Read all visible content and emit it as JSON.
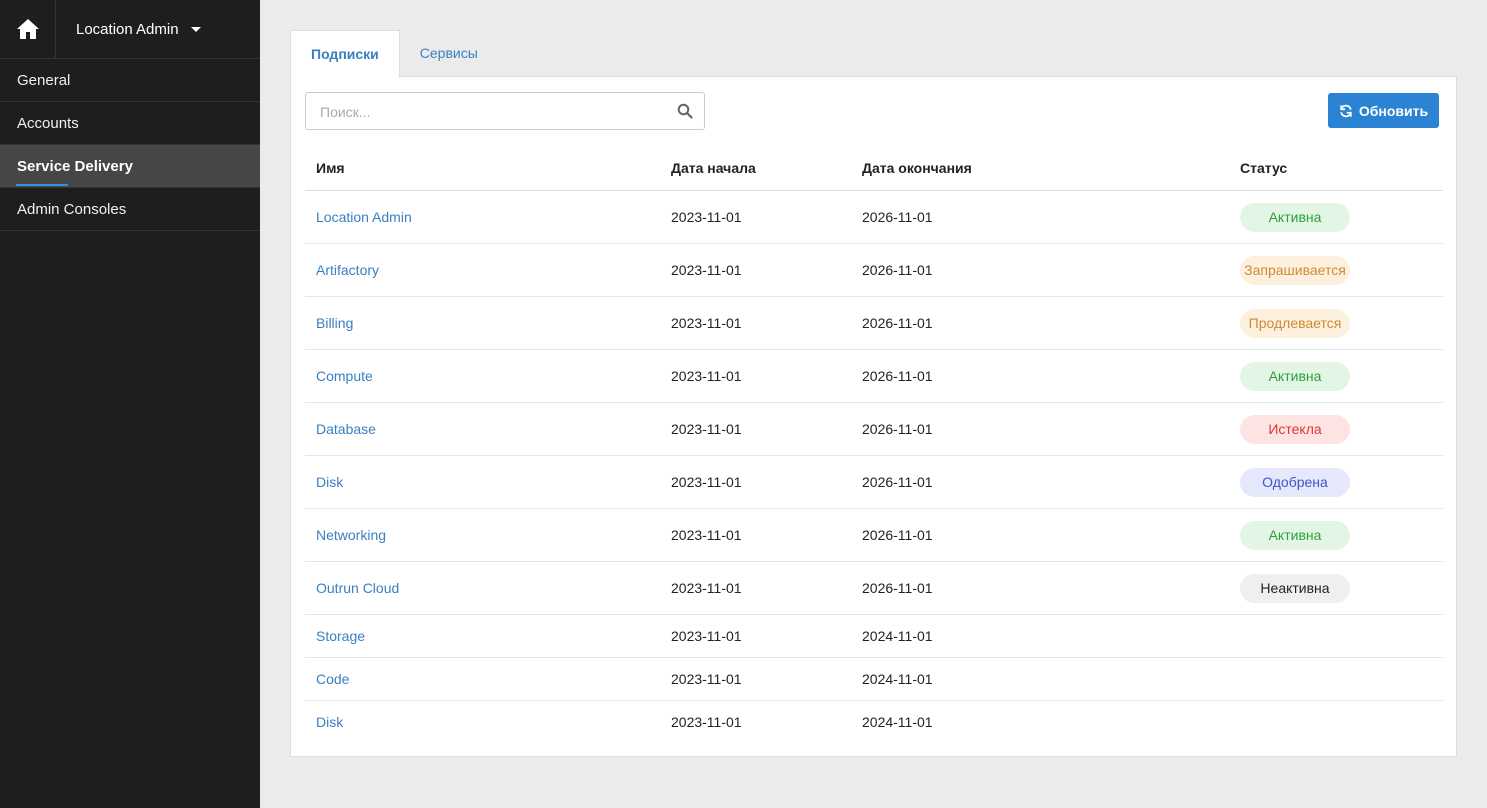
{
  "sidebar": {
    "location": "Location Admin",
    "items": [
      {
        "label": "General",
        "active": false
      },
      {
        "label": "Accounts",
        "active": false
      },
      {
        "label": "Service Delivery",
        "active": true
      },
      {
        "label": "Admin Consoles",
        "active": false
      }
    ]
  },
  "tabs": [
    {
      "label": "Подписки",
      "active": true
    },
    {
      "label": "Сервисы",
      "active": false
    }
  ],
  "search": {
    "placeholder": "Поиск..."
  },
  "refresh_label": "Обновить",
  "table": {
    "headers": [
      "Имя",
      "Дата начала",
      "Дата окончания",
      "Статус"
    ],
    "rows": [
      {
        "name": "Location Admin",
        "start": "2023-11-01",
        "end": "2026-11-01",
        "status": "Активна",
        "status_type": "active"
      },
      {
        "name": "Artifactory",
        "start": "2023-11-01",
        "end": "2026-11-01",
        "status": "Запрашивается",
        "status_type": "pending"
      },
      {
        "name": "Billing",
        "start": "2023-11-01",
        "end": "2026-11-01",
        "status": "Продлевается",
        "status_type": "pending"
      },
      {
        "name": "Compute",
        "start": "2023-11-01",
        "end": "2026-11-01",
        "status": "Активна",
        "status_type": "active"
      },
      {
        "name": "Database",
        "start": "2023-11-01",
        "end": "2026-11-01",
        "status": "Истекла",
        "status_type": "expired"
      },
      {
        "name": "Disk",
        "start": "2023-11-01",
        "end": "2026-11-01",
        "status": "Одобрена",
        "status_type": "approved"
      },
      {
        "name": "Networking",
        "start": "2023-11-01",
        "end": "2026-11-01",
        "status": "Активна",
        "status_type": "active"
      },
      {
        "name": "Outrun Cloud",
        "start": "2023-11-01",
        "end": "2026-11-01",
        "status": "Неактивна",
        "status_type": "inactive"
      },
      {
        "name": "Storage",
        "start": "2023-11-01",
        "end": "2024-11-01",
        "status": "",
        "status_type": ""
      },
      {
        "name": "Code",
        "start": "2023-11-01",
        "end": "2024-11-01",
        "status": "",
        "status_type": ""
      },
      {
        "name": "Disk",
        "start": "2023-11-01",
        "end": "2024-11-01",
        "status": "",
        "status_type": ""
      }
    ]
  },
  "status_colors": {
    "active": {
      "bg": "#e3f6e6",
      "fg": "#2e9e3e"
    },
    "pending": {
      "bg": "#fdf0df",
      "fg": "#d08a30"
    },
    "expired": {
      "bg": "#fde4e2",
      "fg": "#d93a30"
    },
    "approved": {
      "bg": "#e6e8fb",
      "fg": "#3c55c9"
    },
    "inactive": {
      "bg": "#efefef",
      "fg": "#222222"
    }
  }
}
